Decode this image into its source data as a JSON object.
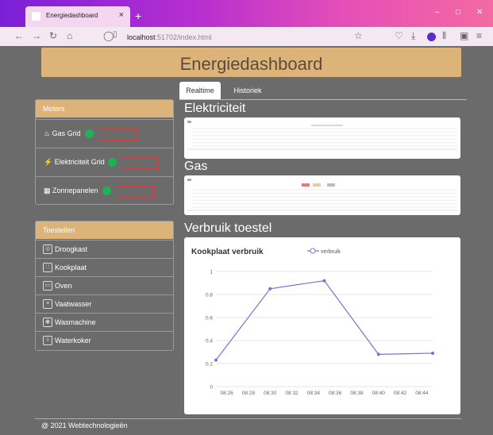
{
  "browser": {
    "tab_title": "Energiedashboard",
    "tab_close": "×",
    "new_tab": "+",
    "url_host": "localhost",
    "url_rest": ":51702/index.html",
    "controls": {
      "minimize": "–",
      "maximize": "□",
      "close": "✕"
    }
  },
  "header": {
    "title": "Energiedashboard"
  },
  "meters": {
    "title": "Meters",
    "items": [
      {
        "label": "Gas Grid",
        "icon": "flame-icon",
        "status_color": "#1db353"
      },
      {
        "label": "Elektriciteit Grid",
        "icon": "bolt-icon",
        "status_color": "#1db353"
      },
      {
        "label": "Zonnepanelen",
        "icon": "solar-panel-icon",
        "status_color": "#1db353"
      }
    ]
  },
  "toestellen": {
    "title": "Toestellen",
    "items": [
      {
        "label": "Droogkast",
        "icon": "dryer-icon"
      },
      {
        "label": "Kookplaat",
        "icon": "cooktop-icon"
      },
      {
        "label": "Oven",
        "icon": "oven-icon"
      },
      {
        "label": "Vaatwasser",
        "icon": "dishwasher-icon"
      },
      {
        "label": "Wasmachine",
        "icon": "washing-machine-icon"
      },
      {
        "label": "Waterkoker",
        "icon": "kettle-icon"
      }
    ]
  },
  "tabs": {
    "realtime": "Realtime",
    "historiek": "Historiek"
  },
  "sections": {
    "elektriciteit": "Elektriciteit",
    "gas": "Gas",
    "verbruik": "Verbruik toestel"
  },
  "footer": {
    "text": "@ 2021 Webtechnologieën"
  },
  "colors": {
    "accent": "#dcb47a",
    "background": "#6b6b6b",
    "line": "#7477c9",
    "status_ok": "#1db353"
  },
  "chart_data": {
    "type": "line",
    "title": "Kookplaat verbruik",
    "xlabel": "",
    "ylabel": "",
    "x": [
      "08:25",
      "08:30",
      "08:35",
      "08:40",
      "08:45"
    ],
    "series": [
      {
        "name": "verbruik",
        "values": [
          0.23,
          0.85,
          0.92,
          0.28,
          0.29
        ]
      }
    ],
    "x_ticks": [
      "08:26",
      "08:28",
      "08:30",
      "08:32",
      "08:34",
      "08:36",
      "08:38",
      "08:40",
      "08:42",
      "08:44"
    ],
    "y_ticks": [
      "0",
      "0.2",
      "0.4",
      "0.6",
      "0.8",
      "1"
    ],
    "ylim": [
      0,
      1
    ],
    "xlim": [
      "08:25",
      "08:45"
    ],
    "grid": true,
    "legend": "top-center"
  }
}
